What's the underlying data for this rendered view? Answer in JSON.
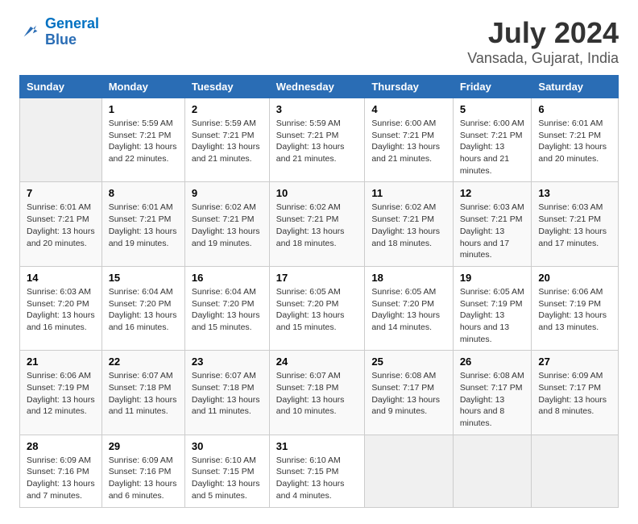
{
  "logo": {
    "line1": "General",
    "line2": "Blue"
  },
  "title": "July 2024",
  "subtitle": "Vansada, Gujarat, India",
  "headers": [
    "Sunday",
    "Monday",
    "Tuesday",
    "Wednesday",
    "Thursday",
    "Friday",
    "Saturday"
  ],
  "weeks": [
    [
      {
        "day": "",
        "sunrise": "",
        "sunset": "",
        "daylight": ""
      },
      {
        "day": "1",
        "sunrise": "Sunrise: 5:59 AM",
        "sunset": "Sunset: 7:21 PM",
        "daylight": "Daylight: 13 hours and 22 minutes."
      },
      {
        "day": "2",
        "sunrise": "Sunrise: 5:59 AM",
        "sunset": "Sunset: 7:21 PM",
        "daylight": "Daylight: 13 hours and 21 minutes."
      },
      {
        "day": "3",
        "sunrise": "Sunrise: 5:59 AM",
        "sunset": "Sunset: 7:21 PM",
        "daylight": "Daylight: 13 hours and 21 minutes."
      },
      {
        "day": "4",
        "sunrise": "Sunrise: 6:00 AM",
        "sunset": "Sunset: 7:21 PM",
        "daylight": "Daylight: 13 hours and 21 minutes."
      },
      {
        "day": "5",
        "sunrise": "Sunrise: 6:00 AM",
        "sunset": "Sunset: 7:21 PM",
        "daylight": "Daylight: 13 hours and 21 minutes."
      },
      {
        "day": "6",
        "sunrise": "Sunrise: 6:01 AM",
        "sunset": "Sunset: 7:21 PM",
        "daylight": "Daylight: 13 hours and 20 minutes."
      }
    ],
    [
      {
        "day": "7",
        "sunrise": "Sunrise: 6:01 AM",
        "sunset": "Sunset: 7:21 PM",
        "daylight": "Daylight: 13 hours and 20 minutes."
      },
      {
        "day": "8",
        "sunrise": "Sunrise: 6:01 AM",
        "sunset": "Sunset: 7:21 PM",
        "daylight": "Daylight: 13 hours and 19 minutes."
      },
      {
        "day": "9",
        "sunrise": "Sunrise: 6:02 AM",
        "sunset": "Sunset: 7:21 PM",
        "daylight": "Daylight: 13 hours and 19 minutes."
      },
      {
        "day": "10",
        "sunrise": "Sunrise: 6:02 AM",
        "sunset": "Sunset: 7:21 PM",
        "daylight": "Daylight: 13 hours and 18 minutes."
      },
      {
        "day": "11",
        "sunrise": "Sunrise: 6:02 AM",
        "sunset": "Sunset: 7:21 PM",
        "daylight": "Daylight: 13 hours and 18 minutes."
      },
      {
        "day": "12",
        "sunrise": "Sunrise: 6:03 AM",
        "sunset": "Sunset: 7:21 PM",
        "daylight": "Daylight: 13 hours and 17 minutes."
      },
      {
        "day": "13",
        "sunrise": "Sunrise: 6:03 AM",
        "sunset": "Sunset: 7:21 PM",
        "daylight": "Daylight: 13 hours and 17 minutes."
      }
    ],
    [
      {
        "day": "14",
        "sunrise": "Sunrise: 6:03 AM",
        "sunset": "Sunset: 7:20 PM",
        "daylight": "Daylight: 13 hours and 16 minutes."
      },
      {
        "day": "15",
        "sunrise": "Sunrise: 6:04 AM",
        "sunset": "Sunset: 7:20 PM",
        "daylight": "Daylight: 13 hours and 16 minutes."
      },
      {
        "day": "16",
        "sunrise": "Sunrise: 6:04 AM",
        "sunset": "Sunset: 7:20 PM",
        "daylight": "Daylight: 13 hours and 15 minutes."
      },
      {
        "day": "17",
        "sunrise": "Sunrise: 6:05 AM",
        "sunset": "Sunset: 7:20 PM",
        "daylight": "Daylight: 13 hours and 15 minutes."
      },
      {
        "day": "18",
        "sunrise": "Sunrise: 6:05 AM",
        "sunset": "Sunset: 7:20 PM",
        "daylight": "Daylight: 13 hours and 14 minutes."
      },
      {
        "day": "19",
        "sunrise": "Sunrise: 6:05 AM",
        "sunset": "Sunset: 7:19 PM",
        "daylight": "Daylight: 13 hours and 13 minutes."
      },
      {
        "day": "20",
        "sunrise": "Sunrise: 6:06 AM",
        "sunset": "Sunset: 7:19 PM",
        "daylight": "Daylight: 13 hours and 13 minutes."
      }
    ],
    [
      {
        "day": "21",
        "sunrise": "Sunrise: 6:06 AM",
        "sunset": "Sunset: 7:19 PM",
        "daylight": "Daylight: 13 hours and 12 minutes."
      },
      {
        "day": "22",
        "sunrise": "Sunrise: 6:07 AM",
        "sunset": "Sunset: 7:18 PM",
        "daylight": "Daylight: 13 hours and 11 minutes."
      },
      {
        "day": "23",
        "sunrise": "Sunrise: 6:07 AM",
        "sunset": "Sunset: 7:18 PM",
        "daylight": "Daylight: 13 hours and 11 minutes."
      },
      {
        "day": "24",
        "sunrise": "Sunrise: 6:07 AM",
        "sunset": "Sunset: 7:18 PM",
        "daylight": "Daylight: 13 hours and 10 minutes."
      },
      {
        "day": "25",
        "sunrise": "Sunrise: 6:08 AM",
        "sunset": "Sunset: 7:17 PM",
        "daylight": "Daylight: 13 hours and 9 minutes."
      },
      {
        "day": "26",
        "sunrise": "Sunrise: 6:08 AM",
        "sunset": "Sunset: 7:17 PM",
        "daylight": "Daylight: 13 hours and 8 minutes."
      },
      {
        "day": "27",
        "sunrise": "Sunrise: 6:09 AM",
        "sunset": "Sunset: 7:17 PM",
        "daylight": "Daylight: 13 hours and 8 minutes."
      }
    ],
    [
      {
        "day": "28",
        "sunrise": "Sunrise: 6:09 AM",
        "sunset": "Sunset: 7:16 PM",
        "daylight": "Daylight: 13 hours and 7 minutes."
      },
      {
        "day": "29",
        "sunrise": "Sunrise: 6:09 AM",
        "sunset": "Sunset: 7:16 PM",
        "daylight": "Daylight: 13 hours and 6 minutes."
      },
      {
        "day": "30",
        "sunrise": "Sunrise: 6:10 AM",
        "sunset": "Sunset: 7:15 PM",
        "daylight": "Daylight: 13 hours and 5 minutes."
      },
      {
        "day": "31",
        "sunrise": "Sunrise: 6:10 AM",
        "sunset": "Sunset: 7:15 PM",
        "daylight": "Daylight: 13 hours and 4 minutes."
      },
      {
        "day": "",
        "sunrise": "",
        "sunset": "",
        "daylight": ""
      },
      {
        "day": "",
        "sunrise": "",
        "sunset": "",
        "daylight": ""
      },
      {
        "day": "",
        "sunrise": "",
        "sunset": "",
        "daylight": ""
      }
    ]
  ]
}
